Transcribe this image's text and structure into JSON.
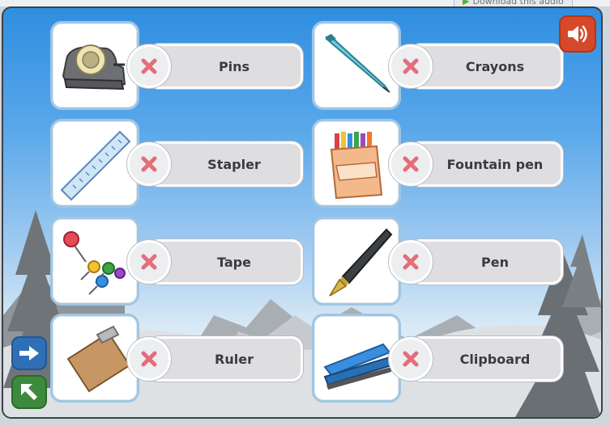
{
  "topbar": {
    "download_label": "Download this audio"
  },
  "pairs": [
    {
      "label": "Pins",
      "picture_icon": "tape-dispenser-icon"
    },
    {
      "label": "Crayons",
      "picture_icon": "ballpoint-pen-icon"
    },
    {
      "label": "Stapler",
      "picture_icon": "ruler-icon"
    },
    {
      "label": "Fountain pen",
      "picture_icon": "crayons-box-icon"
    },
    {
      "label": "Tape",
      "picture_icon": "push-pins-icon"
    },
    {
      "label": "Pen",
      "picture_icon": "fountain-pen-icon"
    },
    {
      "label": "Ruler",
      "picture_icon": "clipboard-icon"
    },
    {
      "label": "Clipboard",
      "picture_icon": "stapler-icon"
    }
  ],
  "controls": {
    "sound_icon": "speaker-icon",
    "next_icon": "arrow-right-icon",
    "back_icon": "arrow-up-left-icon"
  },
  "colors": {
    "sky": "#2f8ee0",
    "label_bg": "#dedee0",
    "x_mark": "#e56d7b",
    "card_border": "#9fc6e2",
    "sound_button": "#d6482a",
    "next_button": "#2f6fb5",
    "back_button": "#3e8a3c"
  }
}
